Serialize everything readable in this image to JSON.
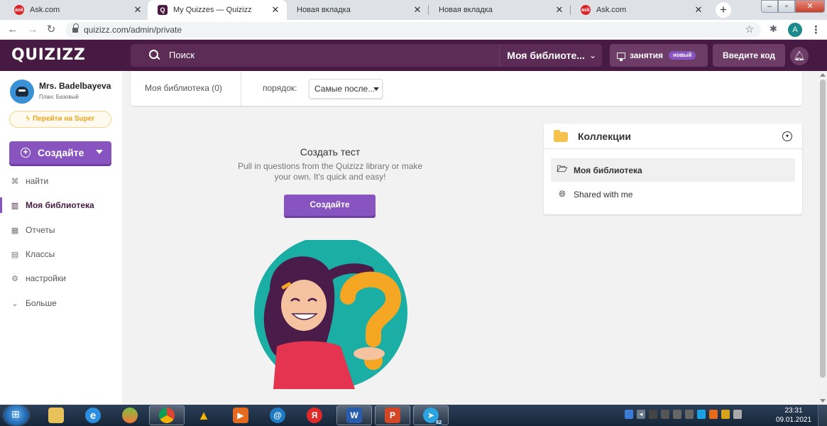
{
  "browser": {
    "tabs": [
      {
        "title": "Ask.com",
        "favicon": "ask-favicon",
        "active": false
      },
      {
        "title": "My Quizzes — Quizizz",
        "favicon": "quizizz-favicon",
        "active": true
      },
      {
        "title": "Новая вкладка",
        "favicon": "",
        "active": false
      },
      {
        "title": "Новая вкладка",
        "favicon": "",
        "active": false
      },
      {
        "title": "Ask.com",
        "favicon": "ask-favicon",
        "active": false
      }
    ],
    "url": "quizizz.com/admin/private",
    "profile_initial": "A"
  },
  "header": {
    "logo": "QUIZIZZ",
    "search_label": "Поиск",
    "library_select": "Моя библиоте...",
    "sessions_label": "занятия",
    "new_badge": "новый",
    "enter_code": "Введите код"
  },
  "sidebar": {
    "user_name": "Mrs. Badelbayeva",
    "plan": "План: Базовый",
    "super_button": "Перейти на Super",
    "create_button": "Создайте",
    "items": [
      {
        "label": "найти",
        "icon": "binoculars-icon",
        "active": false
      },
      {
        "label": "Моя библиотека",
        "icon": "library-icon",
        "active": true
      },
      {
        "label": "Отчеты",
        "icon": "reports-icon",
        "active": false
      },
      {
        "label": "Классы",
        "icon": "classes-icon",
        "active": false
      },
      {
        "label": "настройки",
        "icon": "gear-icon",
        "active": false
      },
      {
        "label": "Больше",
        "icon": "chevron-down-icon",
        "active": false
      }
    ]
  },
  "filters": {
    "library_count": "Моя библиотека (0)",
    "sort_label": "порядок:",
    "sort_value": "Самые после..."
  },
  "empty_state": {
    "title": "Создать тест",
    "description": "Pull in questions from the Quizizz library or make your own. It's quick and easy!",
    "button": "Создайте"
  },
  "collections": {
    "title": "Коллекции",
    "items": [
      {
        "label": "Моя библиотека",
        "icon": "folder-open-icon",
        "selected": true
      },
      {
        "label": "Shared with me",
        "icon": "globe-icon",
        "selected": false
      }
    ]
  },
  "taskbar": {
    "time": "23:31",
    "date": "09.01.2021",
    "yandex_glyph": "Я",
    "word_glyph": "W",
    "telegram_badge": "62"
  },
  "colors": {
    "brand": "#461a42",
    "accent": "#8854c0",
    "super": "#f0b429"
  }
}
